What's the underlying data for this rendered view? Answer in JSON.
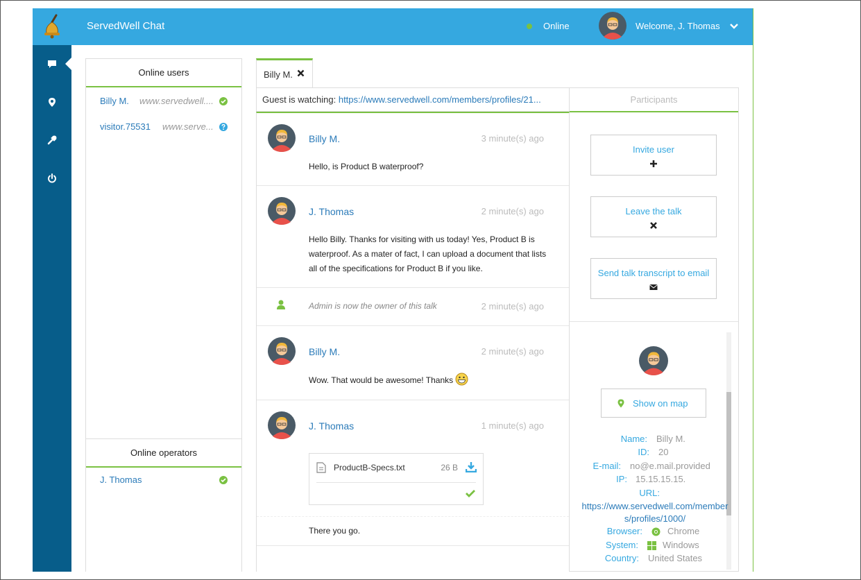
{
  "app": {
    "title": "ServedWell Chat"
  },
  "header": {
    "status": "Online",
    "welcome": "Welcome, J. Thomas"
  },
  "sidebar": {
    "items": [
      {
        "icon": "chat-icon",
        "active": true
      },
      {
        "icon": "map-marker-icon",
        "active": false
      },
      {
        "icon": "wrench-icon",
        "active": false
      },
      {
        "icon": "power-icon",
        "active": false
      }
    ]
  },
  "online_users": {
    "title": "Online users",
    "users": [
      {
        "name": "Billy M.",
        "url": "www.servedwell....",
        "state": "online"
      },
      {
        "name": "visitor.75531",
        "url": "www.serve...",
        "state": "unknown"
      }
    ]
  },
  "online_operators": {
    "title": "Online operators",
    "operators": [
      {
        "name": "J. Thomas",
        "state": "online"
      }
    ]
  },
  "chat": {
    "tab_label": "Billy M.",
    "watching_prefix": "Guest is watching:",
    "watching_url": "https://www.servedwell.com/members/profiles/21...",
    "messages": [
      {
        "author": "Billy M.",
        "time": "3 minute(s) ago",
        "text": "Hello, is Product B waterproof?"
      },
      {
        "author": "J. Thomas",
        "time": "2 minute(s) ago",
        "text": "Hello Billy. Thanks for visiting with us today! Yes, Product B is waterproof. As a mater of fact, I can upload a document that lists all of the specifications for Product B if you like."
      },
      {
        "system": true,
        "time": "2 minute(s) ago",
        "text": "Admin is now the owner of this talk"
      },
      {
        "author": "Billy M.",
        "time": "2 minute(s) ago",
        "text": "Wow. That would be awesome! Thanks"
      },
      {
        "author": "J. Thomas",
        "time": "1 minute(s) ago",
        "file_name": "ProductB-Specs.txt",
        "file_size": "26 B"
      }
    ],
    "trailing_message": "There you go."
  },
  "participants": {
    "title": "Participants",
    "actions": [
      {
        "label": "Invite user",
        "icon": "plus-icon"
      },
      {
        "label": "Leave the talk",
        "icon": "close-icon"
      },
      {
        "label": "Send talk transcript to email",
        "icon": "envelope-icon"
      }
    ],
    "show_on_map": "Show on map",
    "details": {
      "name_label": "Name:",
      "name": "Billy M.",
      "id_label": "ID:",
      "id": "20",
      "email_label": "E-mail:",
      "email": "no@e.mail.provided",
      "ip_label": "IP:",
      "ip": "15.15.15.15.",
      "url_label": "URL:",
      "url": "https://www.servedwell.com/members/profiles/1000/",
      "browser_label": "Browser:",
      "browser": "Chrome",
      "system_label": "System:",
      "system": "Windows",
      "country_label": "Country:",
      "country": "United States"
    }
  },
  "colors": {
    "header": "#35a8e0",
    "sidebar": "#075d8a",
    "accent": "#7ac142",
    "link": "#2b7bb9"
  }
}
